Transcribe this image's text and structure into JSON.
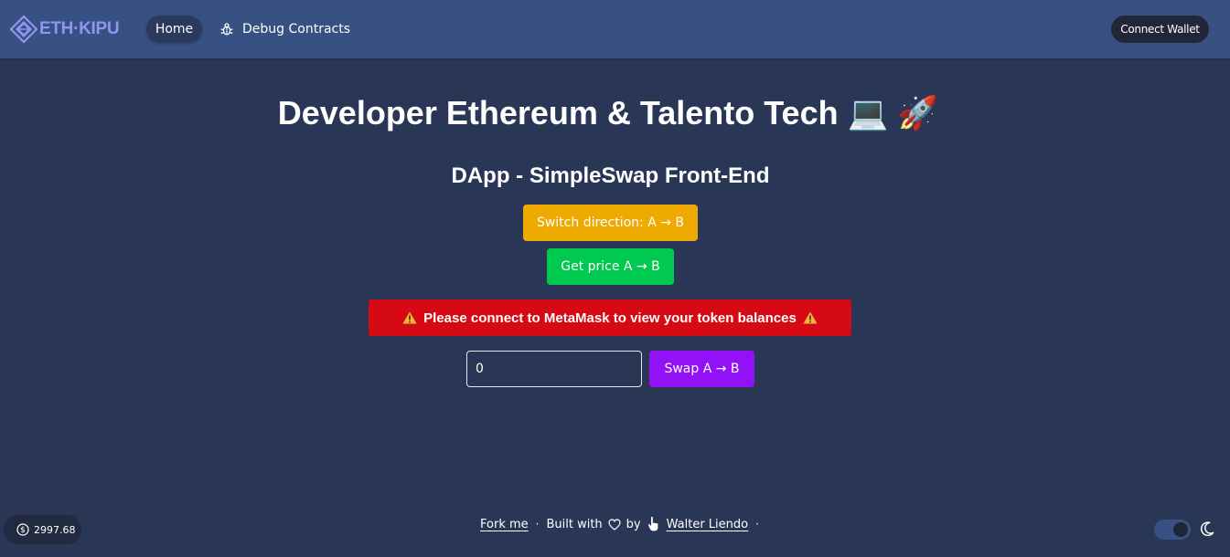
{
  "header": {
    "logo_text": "ETH·KIPU",
    "nav": {
      "home_label": "Home",
      "debug_label": "Debug Contracts"
    },
    "connect_label": "Connect Wallet"
  },
  "main": {
    "title": "Developer Ethereum & Talento Tech 💻 🚀",
    "subtitle": "DApp - SimpleSwap Front-End",
    "switch_label": "Switch direction: A → B",
    "price_label": "Get price A → B",
    "alert_text": "Please connect to MetaMask to view your token balances",
    "amount_value": "0",
    "swap_label": "Swap A → B"
  },
  "footer": {
    "eth_price": "2997.68",
    "fork_label": "Fork me",
    "built_with": "Built with",
    "by_label": "by",
    "author": "Walter Liendo",
    "theme": "dark"
  },
  "colors": {
    "background": "#2a3655",
    "header": "#385183",
    "switch_button": "#eeaa00",
    "price_button": "#00c950",
    "alert": "#d60a14",
    "swap_button": "#9311f7",
    "logo": "#8f95f0"
  },
  "icons": [
    "eth-kipu-logo-icon",
    "bug-icon",
    "warning-icon",
    "dollar-icon",
    "heart-icon",
    "hand-pointer-icon",
    "moon-icon"
  ]
}
